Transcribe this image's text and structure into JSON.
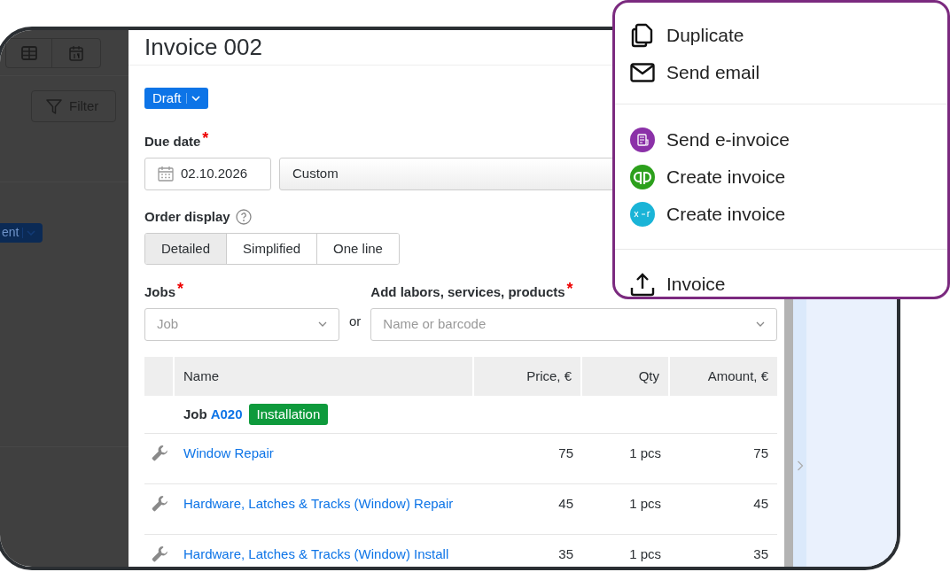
{
  "background": {
    "filter_button": "Filter",
    "status_badge": "ent"
  },
  "invoice": {
    "title": "Invoice 002",
    "status": "Draft",
    "required_mark": "*",
    "due_date": {
      "label": "Due date",
      "required": true,
      "date": "02.10.2026",
      "term": "Custom"
    },
    "order_display": {
      "label": "Order display",
      "options": [
        {
          "label": "Detailed",
          "selected": true
        },
        {
          "label": "Simplified",
          "selected": false
        },
        {
          "label": "One line",
          "selected": false
        }
      ]
    },
    "jobs": {
      "label": "Jobs",
      "required": true,
      "placeholder": "Job"
    },
    "separator": "or",
    "products": {
      "label": "Add labors, services, products",
      "required": true,
      "placeholder": "Name or barcode"
    },
    "table": {
      "columns": [
        "Name",
        "Price, €",
        "Qty",
        "Amount, €"
      ],
      "group": {
        "prefix": "Job",
        "code": "A020",
        "tag": "Installation"
      },
      "rows": [
        {
          "name": "Window Repair",
          "price": "75",
          "qty": "1 pcs",
          "amount": "75"
        },
        {
          "name": "Hardware, Latches & Tracks (Window) Repair",
          "price": "45",
          "qty": "1 pcs",
          "amount": "45"
        },
        {
          "name": "Hardware, Latches & Tracks (Window) Install",
          "price": "35",
          "qty": "1 pcs",
          "amount": "35"
        }
      ]
    }
  },
  "menu": {
    "sections": [
      [
        {
          "kind": "duplicate",
          "label": "Duplicate"
        },
        {
          "kind": "email",
          "label": "Send email"
        }
      ],
      [
        {
          "kind": "e-invoice",
          "label": "Send e-invoice"
        },
        {
          "kind": "quickbooks",
          "label": "Create invoice"
        },
        {
          "kind": "xero",
          "label": "Create invoice"
        }
      ],
      [
        {
          "kind": "upload",
          "label": "Invoice"
        }
      ]
    ]
  }
}
